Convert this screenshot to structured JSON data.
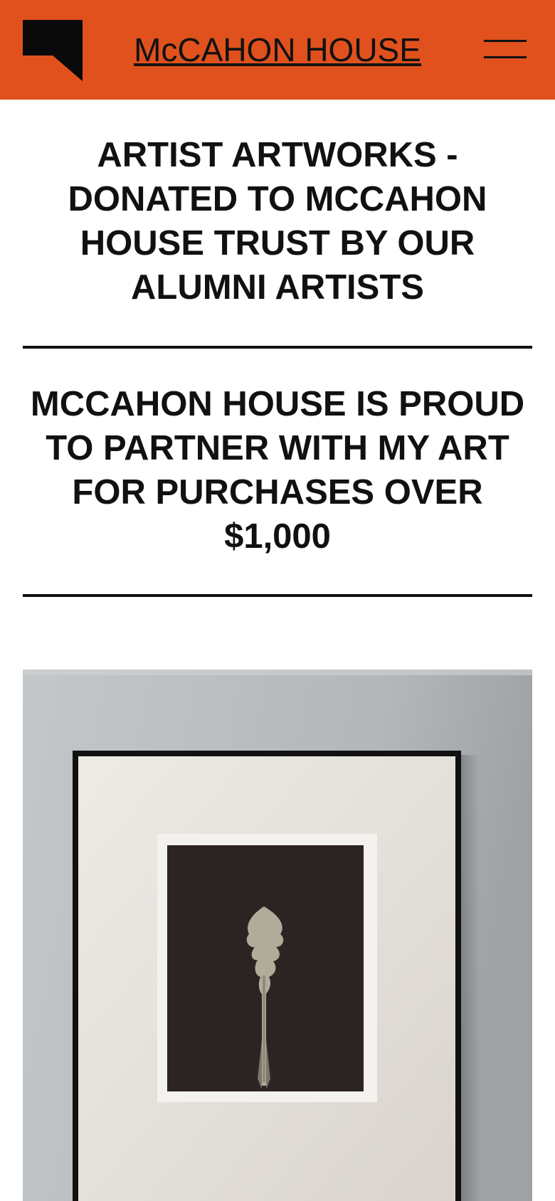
{
  "header": {
    "site_title": "McCAHON HOUSE",
    "background_color": "#e0511d",
    "logo_icon": "mccahon-house-logo-icon",
    "menu_icon": "hamburger-menu-icon"
  },
  "main": {
    "headlines": [
      "ARTIST ARTWORKS - DONATED TO MCCAHON HOUSE TRUST BY OUR ALUMNI ARTISTS",
      "MCCAHON HOUSE IS PROUD TO PARTNER WITH MY ART FOR PURCHASES OVER $1,000"
    ],
    "artwork_image": {
      "subject": "framed botanical photogram print on a grey wall"
    }
  }
}
